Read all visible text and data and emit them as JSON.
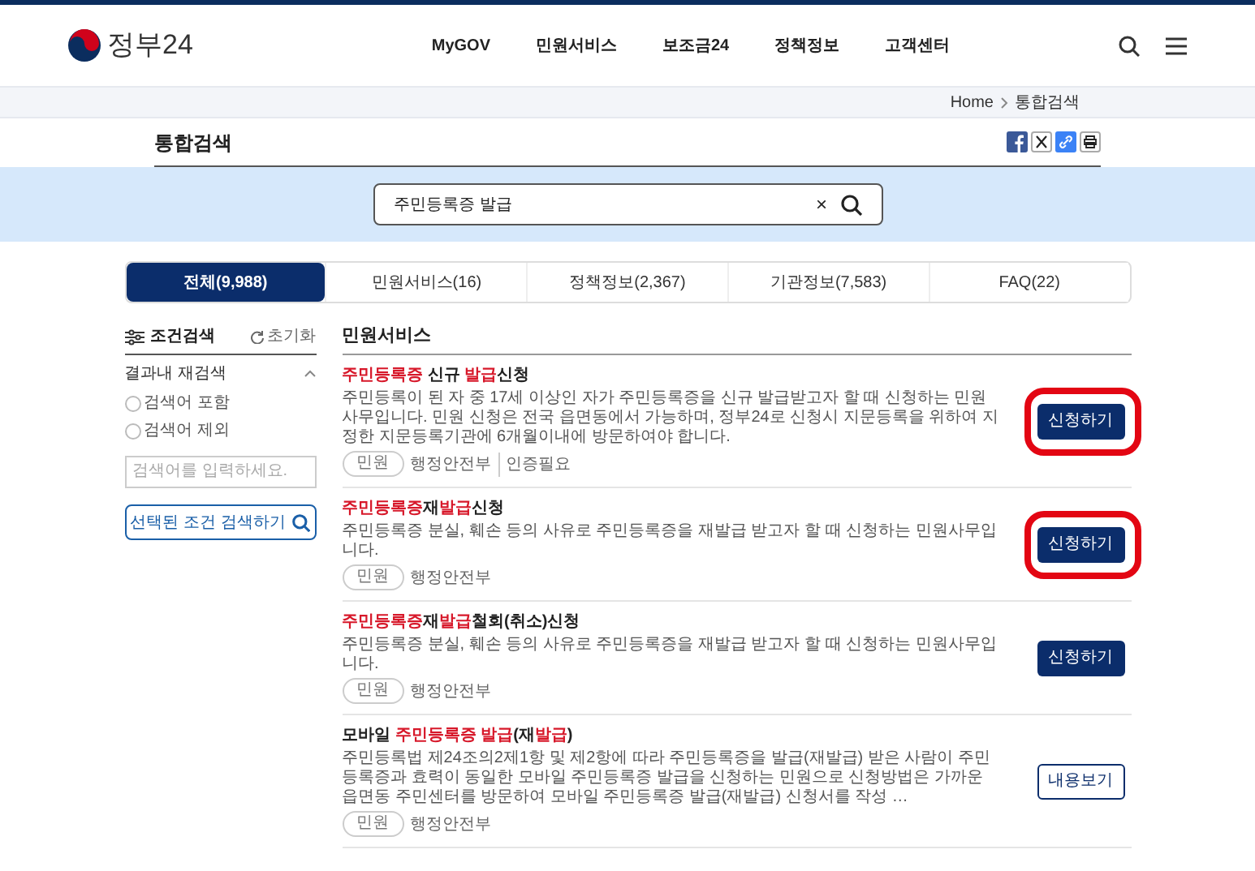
{
  "header": {
    "logo_text": "정부24",
    "nav": [
      "MyGOV",
      "민원서비스",
      "보조금24",
      "정책정보",
      "고객센터"
    ]
  },
  "breadcrumb": [
    "Home",
    "통합검색"
  ],
  "page_title": "통합검색",
  "search": {
    "value": "주민등록증 발급",
    "clear": "×"
  },
  "tabs": [
    {
      "label": "전체(9,988)",
      "selected": true
    },
    {
      "label": "민원서비스(16)",
      "selected": false
    },
    {
      "label": "정책정보(2,367)",
      "selected": false
    },
    {
      "label": "기관정보(7,583)",
      "selected": false
    },
    {
      "label": "FAQ(22)",
      "selected": false
    }
  ],
  "sidebar": {
    "title": "조건검색",
    "reset": "초기화",
    "section": "결과내 재검색",
    "expanded": true,
    "options": [
      {
        "label": "검색어 포함",
        "selected": false
      },
      {
        "label": "검색어 제외",
        "selected": false
      }
    ],
    "placeholder": "검색어를 입력하세요.",
    "button": "선택된 조건 검색하기"
  },
  "section_title": "민원서비스",
  "results": [
    {
      "title": [
        {
          "text": "주민등록증",
          "highlight": true
        },
        {
          "text": " 신규 ",
          "highlight": false
        },
        {
          "text": "발급",
          "highlight": true
        },
        {
          "text": "신청",
          "highlight": false
        }
      ],
      "description": "주민등록이 된 자 중 17세 이상인 자가 주민등록증을 신규 발급받고자 할 때 신청하는 민원사무입니다. 민원 신청은 전국 읍면동에서 가능하며, 정부24로 신청시 지문등록을 위하여 지정한 지문등록기관에 6개월이내에 방문하여야 합니다.",
      "tag": "민원",
      "agency": "행정안전부",
      "note": "인증필요",
      "button": {
        "label": "신청하기",
        "kind": "primary"
      },
      "circled": true
    },
    {
      "title": [
        {
          "text": "주민등록증",
          "highlight": true
        },
        {
          "text": "재",
          "highlight": false
        },
        {
          "text": "발급",
          "highlight": true
        },
        {
          "text": "신청",
          "highlight": false
        }
      ],
      "description": "주민등록증 분실, 훼손 등의 사유로 주민등록증을 재발급 받고자 할 때 신청하는 민원사무입니다.",
      "tag": "민원",
      "agency": "행정안전부",
      "button": {
        "label": "신청하기",
        "kind": "primary"
      },
      "circled": true
    },
    {
      "title": [
        {
          "text": "주민등록증",
          "highlight": true
        },
        {
          "text": "재",
          "highlight": false
        },
        {
          "text": "발급",
          "highlight": true
        },
        {
          "text": "철회(취소)신청",
          "highlight": false
        }
      ],
      "description": "주민등록증 분실, 훼손 등의 사유로 주민등록증을 재발급 받고자 할 때 신청하는 민원사무입니다.",
      "tag": "민원",
      "agency": "행정안전부",
      "button": {
        "label": "신청하기",
        "kind": "primary"
      },
      "circled": false
    },
    {
      "title": [
        {
          "text": "모바일 ",
          "highlight": false
        },
        {
          "text": "주민등록증 발급",
          "highlight": true
        },
        {
          "text": "(재",
          "highlight": false
        },
        {
          "text": "발급",
          "highlight": true
        },
        {
          "text": ")",
          "highlight": false
        }
      ],
      "description": "주민등록법 제24조의2제1항 및 제2항에 따라 주민등록증을 발급(재발급) 받은 사람이 주민등록증과 효력이 동일한 모바일 주민등록증 발급을 신청하는 민원으로 신청방법은 가까운 읍면동 주민센터를 방문하여 모바일 주민등록증 발급(재발급) 신청서를 작성 …",
      "tag": "민원",
      "agency": "행정안전부",
      "button": {
        "label": "내용보기",
        "kind": "outline"
      },
      "circled": false
    }
  ]
}
